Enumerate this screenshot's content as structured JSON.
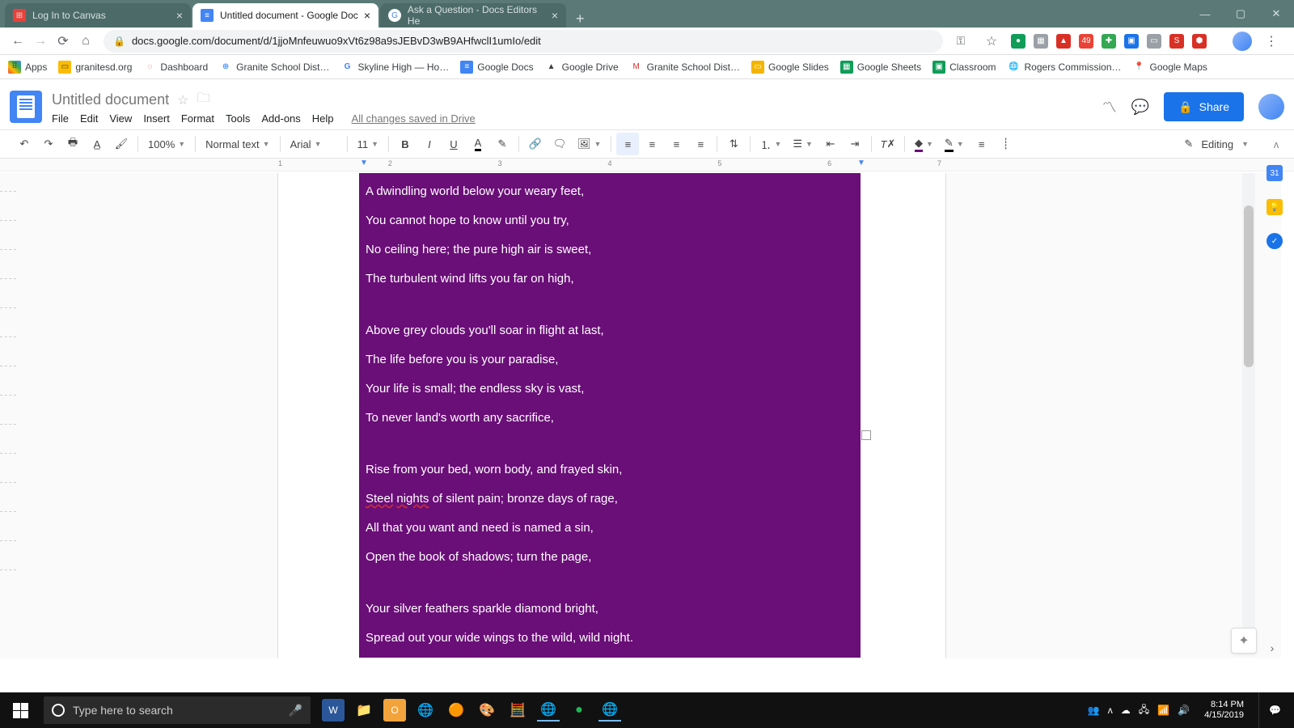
{
  "tabs": [
    {
      "title": "Log In to Canvas"
    },
    {
      "title": "Untitled document - Google Doc"
    },
    {
      "title": "Ask a Question - Docs Editors He"
    }
  ],
  "url": "docs.google.com/document/d/1jjoMnfeuwuo9xVt6z98a9sJEBvD3wB9AHfwclI1umIo/edit",
  "bookmarks": [
    "Apps",
    "granitesd.org",
    "Dashboard",
    "Granite School Dist…",
    "Skyline High — Ho…",
    "Google Docs",
    "Google Drive",
    "Granite School Dist…",
    "Google Slides",
    "Google Sheets",
    "Classroom",
    "Rogers Commission…",
    "Google Maps"
  ],
  "doc": {
    "title": "Untitled document",
    "menus": [
      "File",
      "Edit",
      "View",
      "Insert",
      "Format",
      "Tools",
      "Add-ons",
      "Help"
    ],
    "saved": "All changes saved in Drive",
    "share": "Share"
  },
  "toolbar": {
    "zoom": "100%",
    "style": "Normal text",
    "font": "Arial",
    "size": "11",
    "mode": "Editing"
  },
  "ruler": [
    "1",
    "2",
    "3",
    "4",
    "5",
    "6",
    "7"
  ],
  "content": {
    "s1": [
      "A dwindling world below your weary feet,",
      "You cannot hope to know until you try,",
      "No ceiling here; the pure high air is sweet,",
      "The turbulent wind lifts you far on high,"
    ],
    "s2": [
      "Above grey clouds you'll soar in flight at last,",
      "The life before you is your paradise,",
      "Your life is small; the endless sky is vast,",
      "To never land's worth any sacrifice,"
    ],
    "s3": [
      "Rise from your bed, worn body, and frayed skin,",
      "Steel nights of silent pain; bronze days of rage,",
      "All that you want and need is named a sin,",
      "Open the book of shadows; turn the page,"
    ],
    "s4": [
      "Your silver feathers sparkle diamond bright,",
      "Spread out your wide wings to the wild, wild night."
    ]
  },
  "search_placeholder": "Type here to search",
  "clock": {
    "time": "8:14 PM",
    "date": "4/15/2019"
  }
}
